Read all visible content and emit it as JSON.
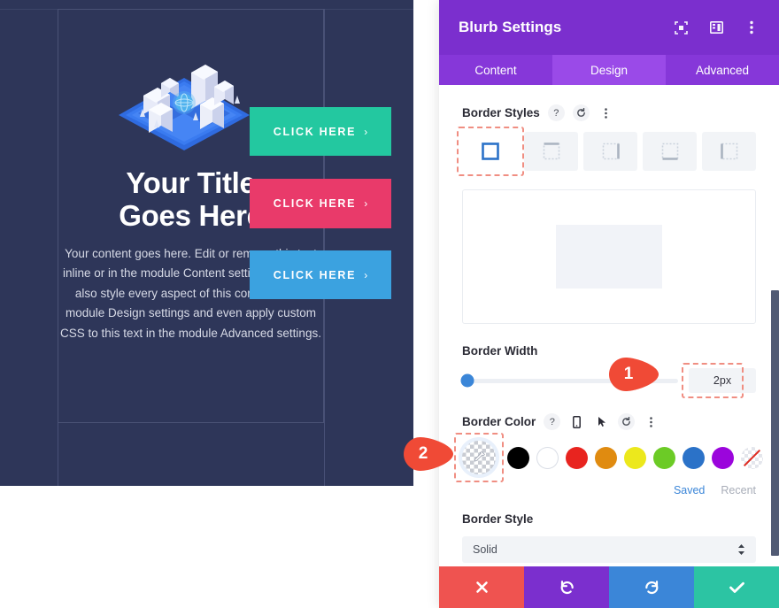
{
  "preview": {
    "title": "Your Title\nGoes Here",
    "title_line1": "Your Title",
    "title_line2": "Goes Here",
    "body": "Your content goes here. Edit or remove this text inline or in the module Content settings. You can also style every aspect of this content in the module Design settings and even apply custom CSS to this text in the module Advanced settings.",
    "buttons": [
      {
        "label": "CLICK HERE",
        "arrow": "›",
        "color": "#23c8a0"
      },
      {
        "label": "CLICK HERE",
        "arrow": "›",
        "color": "#e93a6a"
      },
      {
        "label": "CLICK HERE",
        "arrow": "›",
        "color": "#3ba2e0"
      }
    ],
    "background_color": "#2e3659",
    "illustration": "isometric-city-illustration"
  },
  "modal": {
    "title": "Blurb Settings",
    "header_icons": [
      "expand-icon",
      "layout-icon",
      "more-vertical-icon"
    ],
    "tabs": [
      {
        "label": "Content",
        "active": false
      },
      {
        "label": "Design",
        "active": true
      },
      {
        "label": "Advanced",
        "active": false
      }
    ],
    "border_styles": {
      "label": "Border Styles",
      "icons": [
        "help-icon",
        "reset-icon",
        "more-vertical-icon"
      ],
      "options": [
        {
          "name": "all-borders",
          "selected": true
        },
        {
          "name": "top-border",
          "selected": false
        },
        {
          "name": "right-border",
          "selected": false
        },
        {
          "name": "bottom-border",
          "selected": false
        },
        {
          "name": "left-border",
          "selected": false
        }
      ]
    },
    "border_width": {
      "label": "Border Width",
      "value": "2px",
      "slider_percent": 2
    },
    "border_color": {
      "label": "Border Color",
      "icons": [
        "help-icon",
        "phone-icon",
        "cursor-icon",
        "reset-icon",
        "more-vertical-icon"
      ],
      "current": "transparent-picker",
      "swatches": [
        {
          "name": "black",
          "hex": "#000000"
        },
        {
          "name": "white",
          "hex": "#ffffff"
        },
        {
          "name": "red",
          "hex": "#e8241f"
        },
        {
          "name": "orange",
          "hex": "#e08b10"
        },
        {
          "name": "yellow",
          "hex": "#ece81c"
        },
        {
          "name": "green",
          "hex": "#6ccb26"
        },
        {
          "name": "blue",
          "hex": "#2b72c8"
        },
        {
          "name": "purple",
          "hex": "#9b05dc"
        },
        {
          "name": "none",
          "hex": "transparent"
        }
      ],
      "saved_label": "Saved",
      "recent_label": "Recent"
    },
    "border_style": {
      "label": "Border Style",
      "value": "Solid"
    },
    "footer": [
      {
        "name": "cancel-button",
        "icon": "close-icon",
        "color": "#ef5350"
      },
      {
        "name": "undo-button",
        "icon": "undo-icon",
        "color": "#7b2fce"
      },
      {
        "name": "redo-button",
        "icon": "redo-icon",
        "color": "#3b86d8"
      },
      {
        "name": "save-button",
        "icon": "check-icon",
        "color": "#2cc4a3"
      }
    ]
  },
  "callouts": [
    {
      "number": "1",
      "target": "border-width-value"
    },
    {
      "number": "2",
      "target": "border-color-picker"
    }
  ]
}
